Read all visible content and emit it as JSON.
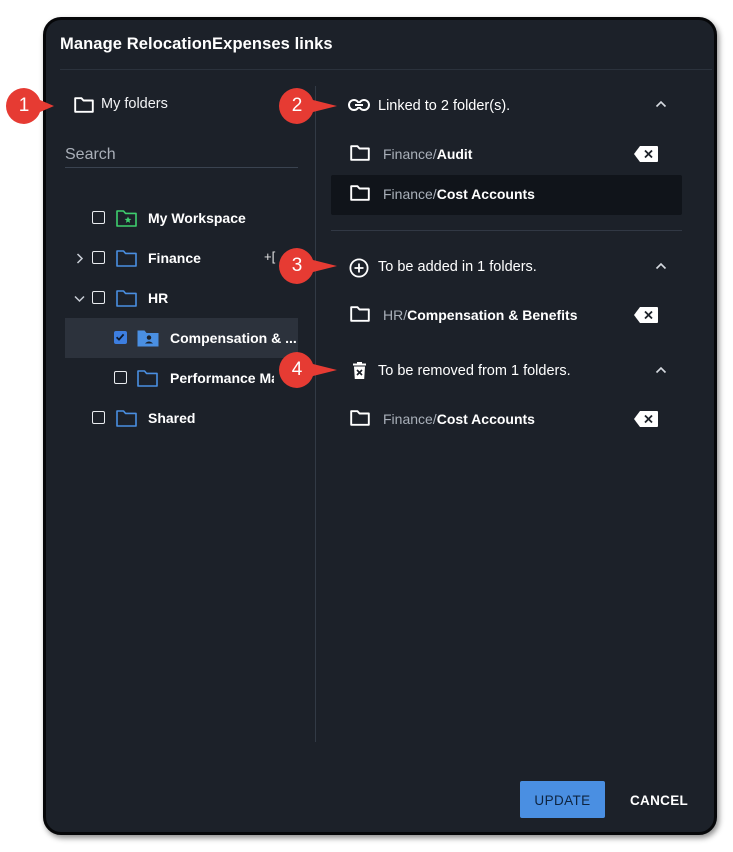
{
  "dialog": {
    "title": "Manage RelocationExpenses links",
    "update_label": "UPDATE",
    "cancel_label": "CANCEL"
  },
  "left": {
    "header": "My folders",
    "search_placeholder": "Search",
    "tree": [
      {
        "label": "My Workspace",
        "checked": false,
        "icon": "folder-star-icon"
      },
      {
        "label": "Finance",
        "checked": false,
        "icon": "folder-icon",
        "expander": "chevron-right-icon",
        "trailing": "+["
      },
      {
        "label": "HR",
        "checked": false,
        "icon": "folder-icon",
        "expander": "chevron-down-icon"
      },
      {
        "label": "Compensation & ...",
        "checked": true,
        "icon": "folder-person-icon",
        "selected": true
      },
      {
        "label": "Performance Ma",
        "checked": false,
        "icon": "folder-icon"
      },
      {
        "label": "Shared",
        "checked": false,
        "icon": "folder-icon"
      }
    ]
  },
  "right": {
    "linked": {
      "title": "Linked to 2 folder(s).",
      "items": [
        {
          "prefix": "Finance/",
          "name": "Audit"
        },
        {
          "prefix": "Finance/",
          "name": "Cost Accounts"
        }
      ]
    },
    "to_add": {
      "title": "To be added in 1 folders.",
      "items": [
        {
          "prefix": "HR/",
          "name": "Compensation & Benefits"
        }
      ]
    },
    "to_remove": {
      "title": "To be removed from 1 folders.",
      "items": [
        {
          "prefix": "Finance/",
          "name": "Cost Accounts"
        }
      ]
    }
  },
  "callouts": [
    "1",
    "2",
    "3",
    "4"
  ],
  "colors": {
    "dialog_bg": "#1c2129",
    "accent_blue": "#4a8fe2",
    "folder_blue": "#4a8fe2",
    "workspace_green": "#3ecf6e",
    "callout_red": "#e63b33"
  }
}
